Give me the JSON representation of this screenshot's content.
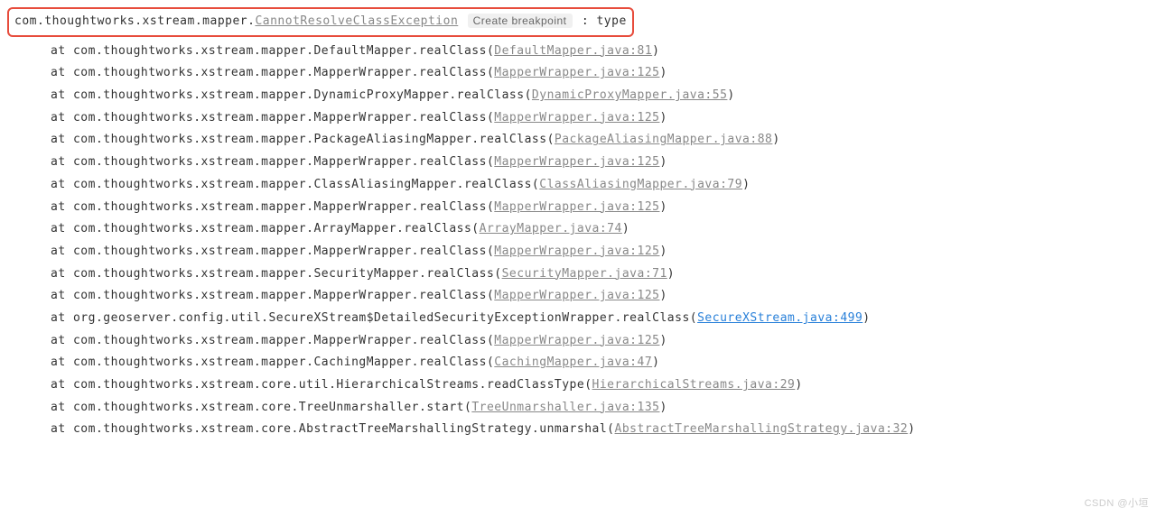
{
  "exception": {
    "package": "com.thoughtworks.xstream.mapper.",
    "class": "CannotResolveClassException",
    "breakpoint_label": "Create breakpoint",
    "message": ": type"
  },
  "stack": [
    {
      "prefix": "at ",
      "method": "com.thoughtworks.xstream.mapper.DefaultMapper.realClass(",
      "file": "DefaultMapper.java:81",
      "suffix": ")",
      "active": false
    },
    {
      "prefix": "at ",
      "method": "com.thoughtworks.xstream.mapper.MapperWrapper.realClass(",
      "file": "MapperWrapper.java:125",
      "suffix": ")",
      "active": false
    },
    {
      "prefix": "at ",
      "method": "com.thoughtworks.xstream.mapper.DynamicProxyMapper.realClass(",
      "file": "DynamicProxyMapper.java:55",
      "suffix": ")",
      "active": false
    },
    {
      "prefix": "at ",
      "method": "com.thoughtworks.xstream.mapper.MapperWrapper.realClass(",
      "file": "MapperWrapper.java:125",
      "suffix": ")",
      "active": false
    },
    {
      "prefix": "at ",
      "method": "com.thoughtworks.xstream.mapper.PackageAliasingMapper.realClass(",
      "file": "PackageAliasingMapper.java:88",
      "suffix": ")",
      "active": false
    },
    {
      "prefix": "at ",
      "method": "com.thoughtworks.xstream.mapper.MapperWrapper.realClass(",
      "file": "MapperWrapper.java:125",
      "suffix": ")",
      "active": false
    },
    {
      "prefix": "at ",
      "method": "com.thoughtworks.xstream.mapper.ClassAliasingMapper.realClass(",
      "file": "ClassAliasingMapper.java:79",
      "suffix": ")",
      "active": false
    },
    {
      "prefix": "at ",
      "method": "com.thoughtworks.xstream.mapper.MapperWrapper.realClass(",
      "file": "MapperWrapper.java:125",
      "suffix": ")",
      "active": false
    },
    {
      "prefix": "at ",
      "method": "com.thoughtworks.xstream.mapper.ArrayMapper.realClass(",
      "file": "ArrayMapper.java:74",
      "suffix": ")",
      "active": false
    },
    {
      "prefix": "at ",
      "method": "com.thoughtworks.xstream.mapper.MapperWrapper.realClass(",
      "file": "MapperWrapper.java:125",
      "suffix": ")",
      "active": false
    },
    {
      "prefix": "at ",
      "method": "com.thoughtworks.xstream.mapper.SecurityMapper.realClass(",
      "file": "SecurityMapper.java:71",
      "suffix": ")",
      "active": false
    },
    {
      "prefix": "at ",
      "method": "com.thoughtworks.xstream.mapper.MapperWrapper.realClass(",
      "file": "MapperWrapper.java:125",
      "suffix": ")",
      "active": false
    },
    {
      "prefix": "at ",
      "method": "org.geoserver.config.util.SecureXStream$DetailedSecurityExceptionWrapper.realClass(",
      "file": "SecureXStream.java:499",
      "suffix": ")",
      "active": true
    },
    {
      "prefix": "at ",
      "method": "com.thoughtworks.xstream.mapper.MapperWrapper.realClass(",
      "file": "MapperWrapper.java:125",
      "suffix": ")",
      "active": false
    },
    {
      "prefix": "at ",
      "method": "com.thoughtworks.xstream.mapper.CachingMapper.realClass(",
      "file": "CachingMapper.java:47",
      "suffix": ")",
      "active": false
    },
    {
      "prefix": "at ",
      "method": "com.thoughtworks.xstream.core.util.HierarchicalStreams.readClassType(",
      "file": "HierarchicalStreams.java:29",
      "suffix": ")",
      "active": false
    },
    {
      "prefix": "at ",
      "method": "com.thoughtworks.xstream.core.TreeUnmarshaller.start(",
      "file": "TreeUnmarshaller.java:135",
      "suffix": ")",
      "active": false
    },
    {
      "prefix": "at ",
      "method": "com.thoughtworks.xstream.core.AbstractTreeMarshallingStrategy.unmarshal(",
      "file": "AbstractTreeMarshallingStrategy.java:32",
      "suffix": ")",
      "active": false
    }
  ],
  "watermark": "CSDN @小垣"
}
